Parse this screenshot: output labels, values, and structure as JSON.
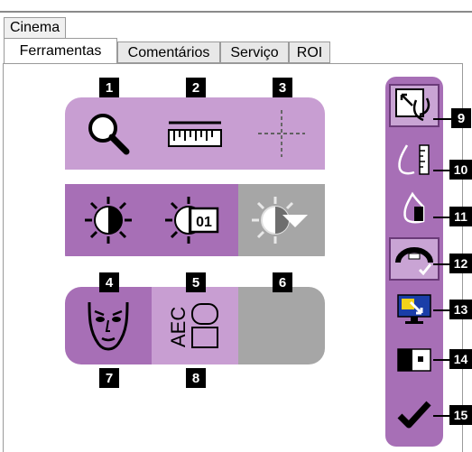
{
  "window_tab": "Cinema",
  "tabs": [
    {
      "label": "Ferramentas"
    },
    {
      "label": "Comentários"
    },
    {
      "label": "Serviço"
    },
    {
      "label": "ROI"
    }
  ],
  "callouts": {
    "n1": "1",
    "n2": "2",
    "n3": "3",
    "n4": "4",
    "n5": "5",
    "n6": "6",
    "n7": "7",
    "n8": "8",
    "n9": "9",
    "n10": "10",
    "n11": "11",
    "n12": "12",
    "n13": "13",
    "n14": "14",
    "n15": "15"
  },
  "icon_text": {
    "dose_box": "01",
    "aec": "AEC"
  },
  "colors": {
    "tool_light": "#c89ed2",
    "tool_dark": "#a76fb6",
    "tool_disabled": "#a6a6a6"
  }
}
